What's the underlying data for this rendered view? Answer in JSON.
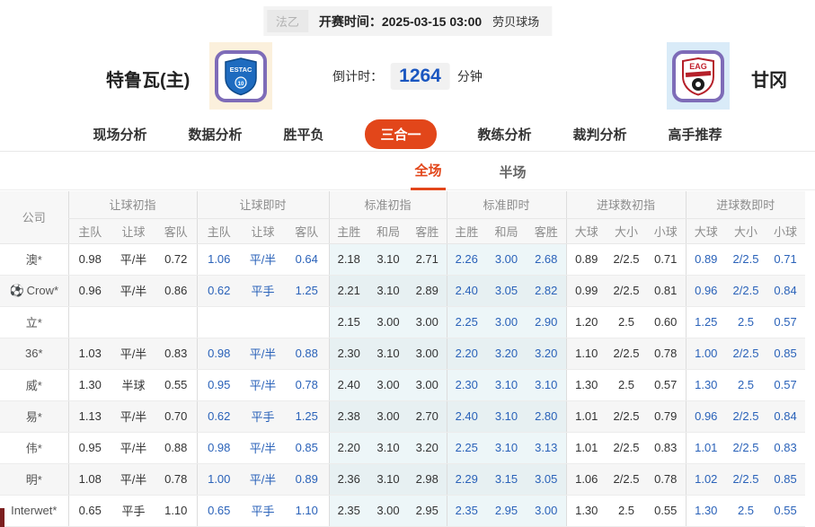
{
  "match_bar": {
    "league": "法乙",
    "kickoff": "开赛时间：2025-03-15 03:00",
    "venue": "劳贝球场"
  },
  "teams": {
    "home": {
      "name": "特鲁瓦(主)",
      "badge_text": "ESTAC",
      "badge_number": "10"
    },
    "away": {
      "name": "甘冈",
      "badge_text": "EAG"
    }
  },
  "countdown": {
    "label": "倒计时：",
    "value": "1264",
    "unit": "分钟"
  },
  "nav_tabs": [
    {
      "label": "现场分析",
      "active": false
    },
    {
      "label": "数据分析",
      "active": false
    },
    {
      "label": "胜平负",
      "active": false
    },
    {
      "label": "三合一",
      "active": true
    },
    {
      "label": "教练分析",
      "active": false
    },
    {
      "label": "裁判分析",
      "active": false
    },
    {
      "label": "高手推荐",
      "active": false
    }
  ],
  "sub_tabs": [
    {
      "label": "全场",
      "active": true
    },
    {
      "label": "半场",
      "active": false
    }
  ],
  "odds_table": {
    "company_header": "公司",
    "groups": [
      {
        "label": "让球初指",
        "cols": [
          "主队",
          "让球",
          "客队"
        ]
      },
      {
        "label": "让球即时",
        "cols": [
          "主队",
          "让球",
          "客队"
        ]
      },
      {
        "label": "标准初指",
        "cols": [
          "主胜",
          "和局",
          "客胜"
        ]
      },
      {
        "label": "标准即时",
        "cols": [
          "主胜",
          "和局",
          "客胜"
        ]
      },
      {
        "label": "进球数初指",
        "cols": [
          "大球",
          "大小",
          "小球"
        ]
      },
      {
        "label": "进球数即时",
        "cols": [
          "大球",
          "大小",
          "小球"
        ]
      }
    ],
    "rows": [
      {
        "company": "澳*",
        "icon": "",
        "init_handicap": [
          "0.98",
          "平/半",
          "0.72"
        ],
        "live_handicap": [
          "1.06",
          "平/半",
          "0.64"
        ],
        "init_std": [
          "2.18",
          "3.10",
          "2.71"
        ],
        "live_std": [
          "2.26",
          "3.00",
          "2.68"
        ],
        "init_goals": [
          "0.89",
          "2/2.5",
          "0.71"
        ],
        "live_goals": [
          "0.89",
          "2/2.5",
          "0.71"
        ]
      },
      {
        "company": "Crow*",
        "icon": "soccer-ball",
        "init_handicap": [
          "0.96",
          "平/半",
          "0.86"
        ],
        "live_handicap": [
          "0.62",
          "平手",
          "1.25"
        ],
        "init_std": [
          "2.21",
          "3.10",
          "2.89"
        ],
        "live_std": [
          "2.40",
          "3.05",
          "2.82"
        ],
        "init_goals": [
          "0.99",
          "2/2.5",
          "0.81"
        ],
        "live_goals": [
          "0.96",
          "2/2.5",
          "0.84"
        ]
      },
      {
        "company": "立*",
        "icon": "",
        "init_handicap": [
          "",
          "",
          ""
        ],
        "live_handicap": [
          "",
          "",
          ""
        ],
        "init_std": [
          "2.15",
          "3.00",
          "3.00"
        ],
        "live_std": [
          "2.25",
          "3.00",
          "2.90"
        ],
        "init_goals": [
          "1.20",
          "2.5",
          "0.60"
        ],
        "live_goals": [
          "1.25",
          "2.5",
          "0.57"
        ]
      },
      {
        "company": "36*",
        "icon": "",
        "init_handicap": [
          "1.03",
          "平/半",
          "0.83"
        ],
        "live_handicap": [
          "0.98",
          "平/半",
          "0.88"
        ],
        "init_std": [
          "2.30",
          "3.10",
          "3.00"
        ],
        "live_std": [
          "2.20",
          "3.20",
          "3.20"
        ],
        "init_goals": [
          "1.10",
          "2/2.5",
          "0.78"
        ],
        "live_goals": [
          "1.00",
          "2/2.5",
          "0.85"
        ]
      },
      {
        "company": "威*",
        "icon": "",
        "init_handicap": [
          "1.30",
          "半球",
          "0.55"
        ],
        "live_handicap": [
          "0.95",
          "平/半",
          "0.78"
        ],
        "init_std": [
          "2.40",
          "3.00",
          "3.00"
        ],
        "live_std": [
          "2.30",
          "3.10",
          "3.10"
        ],
        "init_goals": [
          "1.30",
          "2.5",
          "0.57"
        ],
        "live_goals": [
          "1.30",
          "2.5",
          "0.57"
        ]
      },
      {
        "company": "易*",
        "icon": "",
        "init_handicap": [
          "1.13",
          "平/半",
          "0.70"
        ],
        "live_handicap": [
          "0.62",
          "平手",
          "1.25"
        ],
        "init_std": [
          "2.38",
          "3.00",
          "2.70"
        ],
        "live_std": [
          "2.40",
          "3.10",
          "2.80"
        ],
        "init_goals": [
          "1.01",
          "2/2.5",
          "0.79"
        ],
        "live_goals": [
          "0.96",
          "2/2.5",
          "0.84"
        ]
      },
      {
        "company": "伟*",
        "icon": "",
        "init_handicap": [
          "0.95",
          "平/半",
          "0.88"
        ],
        "live_handicap": [
          "0.98",
          "平/半",
          "0.85"
        ],
        "init_std": [
          "2.20",
          "3.10",
          "3.20"
        ],
        "live_std": [
          "2.25",
          "3.10",
          "3.13"
        ],
        "init_goals": [
          "1.01",
          "2/2.5",
          "0.83"
        ],
        "live_goals": [
          "1.01",
          "2/2.5",
          "0.83"
        ]
      },
      {
        "company": "明*",
        "icon": "",
        "init_handicap": [
          "1.08",
          "平/半",
          "0.78"
        ],
        "live_handicap": [
          "1.00",
          "平/半",
          "0.89"
        ],
        "init_std": [
          "2.36",
          "3.10",
          "2.98"
        ],
        "live_std": [
          "2.29",
          "3.15",
          "3.05"
        ],
        "init_goals": [
          "1.06",
          "2/2.5",
          "0.78"
        ],
        "live_goals": [
          "1.02",
          "2/2.5",
          "0.85"
        ]
      },
      {
        "company": "Interwet*",
        "icon": "",
        "init_handicap": [
          "0.65",
          "平手",
          "1.10"
        ],
        "live_handicap": [
          "0.65",
          "平手",
          "1.10"
        ],
        "init_std": [
          "2.35",
          "3.00",
          "2.95"
        ],
        "live_std": [
          "2.35",
          "2.95",
          "3.00"
        ],
        "init_goals": [
          "1.30",
          "2.5",
          "0.55"
        ],
        "live_goals": [
          "1.30",
          "2.5",
          "0.55"
        ]
      }
    ]
  },
  "colors": {
    "accent_orange": "#e2461a",
    "live_odds_blue": "#2a62b9",
    "countdown_blue": "#1a56c0",
    "badge_border_purple": "#7e6cb8",
    "home_badge_bg": "#fbf0dc",
    "away_badge_bg": "#d9ebf8"
  }
}
